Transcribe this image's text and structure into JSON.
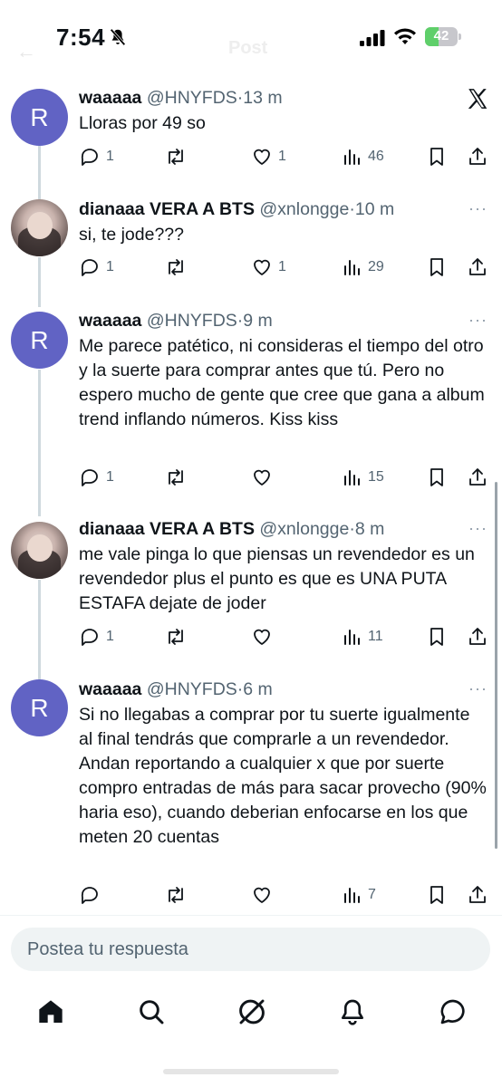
{
  "status_bar": {
    "time": "7:54",
    "battery_percent": "42",
    "battery_level": 0.42,
    "icons": [
      "bell-slash-icon",
      "signal-icon",
      "wifi-icon",
      "battery-icon"
    ]
  },
  "header": {
    "back_icon": "arrow-left-icon",
    "title": "Post"
  },
  "tweets": [
    {
      "avatar_letter": "R",
      "name": "waaaaa",
      "handle": "@HNYFDS",
      "separator": "·",
      "time": "13 m",
      "text": "Lloras por 49 so",
      "replies": "1",
      "retweets": "",
      "likes": "1",
      "views": "46"
    },
    {
      "avatar_letter": "",
      "name": "dianaaa VERA A BTS",
      "handle": "@xnlongge",
      "separator": "·",
      "time": "10 m",
      "text": "si, te jode???",
      "replies": "1",
      "retweets": "",
      "likes": "1",
      "views": "29"
    },
    {
      "avatar_letter": "R",
      "name": "waaaaa",
      "handle": "@HNYFDS",
      "separator": "·",
      "time": "9 m",
      "text": "Me parece patético, ni consideras el tiempo del otro y la suerte para comprar antes que tú. Pero no espero mucho de gente que cree que gana a album trend inflando números. Kiss kiss",
      "replies": "1",
      "retweets": "",
      "likes": "",
      "views": "15"
    },
    {
      "avatar_letter": "",
      "name": "dianaaa VERA A BTS",
      "handle": "@xnlongge",
      "separator": "·",
      "time": "8 m",
      "text": "me vale pinga lo que piensas un revendedor es un revendedor plus el punto es que es UNA PUTA ESTAFA dejate de joder",
      "replies": "1",
      "retweets": "",
      "likes": "",
      "views": "11"
    },
    {
      "avatar_letter": "R",
      "name": "waaaaa",
      "handle": "@HNYFDS",
      "separator": "·",
      "time": "6 m",
      "text": "Si no llegabas a comprar por tu suerte igualmente al final tendrás que comprarle a un revendedor. Andan reportando a cualquier x que por suerte compro entradas de más para sacar provecho (90% haria eso), cuando deberian enfocarse en los que meten 20 cuentas",
      "replies": "",
      "retweets": "",
      "likes": "",
      "views": "7"
    }
  ],
  "more_label": "···",
  "reply_box": {
    "placeholder": "Postea tu respuesta"
  },
  "tabbar": [
    "home-icon",
    "search-icon",
    "grok-icon",
    "bell-icon",
    "message-icon"
  ],
  "colors": {
    "avatar": "#6163c4",
    "text": "#0f1419",
    "muted": "#536471",
    "thread_line": "#cfd9de"
  }
}
